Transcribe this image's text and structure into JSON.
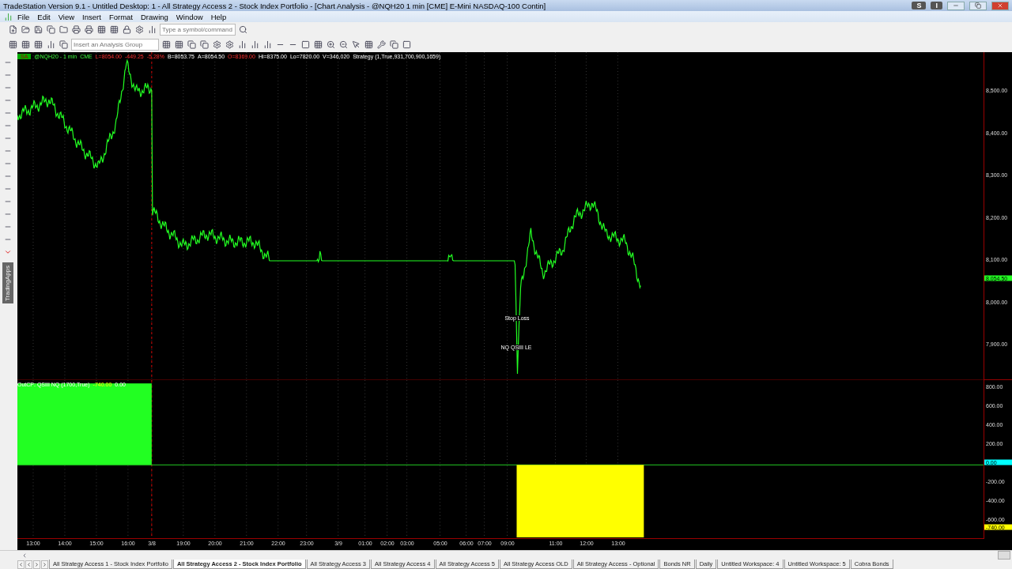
{
  "window": {
    "title": "TradeStation Version 9.1 - Untitled Desktop: 1 - All Strategy Access 2 - Stock Index Portfolio - [Chart Analysis - @NQH20 1 min [CME] E-Mini NASDAQ-100 Contin]",
    "badges": [
      "S",
      "I"
    ]
  },
  "menu": [
    "File",
    "Edit",
    "View",
    "Insert",
    "Format",
    "Drawing",
    "Window",
    "Help"
  ],
  "toolbar": {
    "symbol_placeholder": "Type a symbol/command",
    "analysis_group_placeholder": "Insert an Analysis Group"
  },
  "side_panel": {
    "label": "TradingApps"
  },
  "chart": {
    "status_badge": "SA",
    "quote": [
      {
        "text": "@NQH20 - 1 min",
        "kind": "symbol"
      },
      {
        "text": "CME",
        "kind": "symbol"
      },
      {
        "text": "L=8054.00",
        "kind": "down"
      },
      {
        "text": "-449.25",
        "kind": "down"
      },
      {
        "text": "-5.28%",
        "kind": "down"
      },
      {
        "text": "B=8053.75",
        "kind": "plain"
      },
      {
        "text": "A=8054.50",
        "kind": "plain"
      },
      {
        "text": "O=8369.00",
        "kind": "down"
      },
      {
        "text": "Hi=8375.00",
        "kind": "plain"
      },
      {
        "text": "Lo=7820.00",
        "kind": "plain"
      },
      {
        "text": "V=346,020",
        "kind": "plain"
      },
      {
        "text": "Strategy (1,True,931,700,900,1659)",
        "kind": "plain"
      }
    ],
    "price_axis": [
      "8,500.00",
      "8,400.00",
      "8,300.00",
      "8,200.00",
      "8,100.00",
      "8,000.00",
      "7,900.00"
    ],
    "last_price": "8,054.50",
    "annotations": [
      "Stop Loss",
      "NQ QSIII LE"
    ],
    "indicator": {
      "label": "OutCP: QSIII NQ (1700,True)",
      "value": "-740.00",
      "value_2": "0.00"
    },
    "indicator_axis": [
      "800.00",
      "600.00",
      "400.00",
      "200.00",
      "-200.00",
      "-400.00",
      "-600.00"
    ],
    "zero_marker": "0.00",
    "last_marker": "-740.00",
    "time_axis": [
      "13:00",
      "14:00",
      "15:00",
      "16:00",
      "3/8",
      "19:00",
      "20:00",
      "21:00",
      "22:00",
      "23:00",
      "3/9",
      "01:00",
      "02:00",
      "03:00",
      "05:00",
      "06:00",
      "07:00",
      "09:00",
      "11:00",
      "12:00",
      "13:00"
    ]
  },
  "tabs": [
    {
      "label": "All Strategy Access 1 - Stock Index Portfolio",
      "selected": false
    },
    {
      "label": "All Strategy Access 2 - Stock Index Portfolio",
      "selected": true
    },
    {
      "label": "All Strategy Access 3",
      "selected": false
    },
    {
      "label": "All Strategy Access 4",
      "selected": false
    },
    {
      "label": "All Strategy Access 5",
      "selected": false
    },
    {
      "label": "All Strategy Access OLD",
      "selected": false
    },
    {
      "label": "All Strategy Access - Optional",
      "selected": false
    },
    {
      "label": "Bonds NR",
      "selected": false
    },
    {
      "label": "Daily",
      "selected": false
    },
    {
      "label": "Untitled Workspace:  4",
      "selected": false
    },
    {
      "label": "Untitled Workspace:  5",
      "selected": false
    },
    {
      "label": "Cobra Bonds",
      "selected": false
    }
  ]
}
